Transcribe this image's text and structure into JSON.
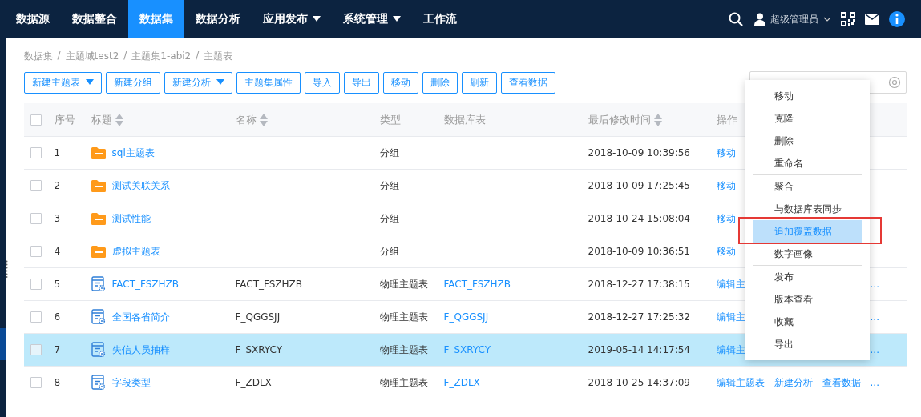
{
  "nav": {
    "items": [
      {
        "label": "数据源",
        "selected": false,
        "dropdown": false
      },
      {
        "label": "数据整合",
        "selected": false,
        "dropdown": false
      },
      {
        "label": "数据集",
        "selected": true,
        "dropdown": false
      },
      {
        "label": "数据分析",
        "selected": false,
        "dropdown": false
      },
      {
        "label": "应用发布",
        "selected": false,
        "dropdown": true
      },
      {
        "label": "系统管理",
        "selected": false,
        "dropdown": true
      },
      {
        "label": "工作流",
        "selected": false,
        "dropdown": false
      }
    ],
    "user": "超级管理员"
  },
  "breadcrumb": {
    "separator": "/",
    "items": [
      "数据集",
      "主题域test2",
      "主题集1-abi2",
      "主题表"
    ]
  },
  "toolbar": [
    {
      "label": "新建主题表",
      "dropdown": true
    },
    {
      "label": "新建分组",
      "dropdown": false
    },
    {
      "label": "新建分析",
      "dropdown": true
    },
    {
      "label": "主题集属性",
      "dropdown": false
    },
    {
      "label": "导入",
      "dropdown": false
    },
    {
      "label": "导出",
      "dropdown": false
    },
    {
      "label": "移动",
      "dropdown": false
    },
    {
      "label": "删除",
      "dropdown": false
    },
    {
      "label": "刷新",
      "dropdown": false
    },
    {
      "label": "查看数据",
      "dropdown": false
    }
  ],
  "table": {
    "all_checked": false,
    "columns": [
      {
        "label": "序号",
        "sortable": false
      },
      {
        "label": "标题",
        "sortable": true
      },
      {
        "label": "名称",
        "sortable": true
      },
      {
        "label": "类型",
        "sortable": false
      },
      {
        "label": "数据库表",
        "sortable": false
      },
      {
        "label": "最后修改时间",
        "sortable": true
      },
      {
        "label": "操作",
        "sortable": false
      }
    ],
    "rows": [
      {
        "index": "1",
        "kind": "folder",
        "title": "sql主题表",
        "name": "",
        "type": "分组",
        "db_table": "",
        "modified": "2018-10-09 10:39:56",
        "actions": [
          "移动"
        ],
        "more": "",
        "selected": false,
        "checked": false
      },
      {
        "index": "2",
        "kind": "folder",
        "title": "测试关联关系",
        "name": "",
        "type": "分组",
        "db_table": "",
        "modified": "2018-10-09 17:25:45",
        "actions": [
          "移动"
        ],
        "more": "",
        "selected": false,
        "checked": false
      },
      {
        "index": "3",
        "kind": "folder",
        "title": "测试性能",
        "name": "",
        "type": "分组",
        "db_table": "",
        "modified": "2018-10-24 15:08:04",
        "actions": [
          "移动"
        ],
        "more": "",
        "selected": false,
        "checked": false
      },
      {
        "index": "4",
        "kind": "folder",
        "title": "虚拟主题表",
        "name": "",
        "type": "分组",
        "db_table": "",
        "modified": "2018-10-09 10:36:51",
        "actions": [
          "移动"
        ],
        "more": "",
        "selected": false,
        "checked": false
      },
      {
        "index": "5",
        "kind": "table",
        "title": "FACT_FSZHZB",
        "name": "FACT_FSZHZB",
        "type": "物理主题表",
        "db_table": "FACT_FSZHZB",
        "modified": "2018-12-27 17:38:15",
        "actions": [
          "编辑主"
        ],
        "more": "...",
        "selected": false,
        "checked": false
      },
      {
        "index": "6",
        "kind": "table",
        "title": "全国各省简介",
        "name": "F_QGGSJJ",
        "type": "物理主题表",
        "db_table": "F_QGGSJJ",
        "modified": "2018-12-27 17:25:32",
        "actions": [
          "编辑主"
        ],
        "more": "...",
        "selected": false,
        "checked": false
      },
      {
        "index": "7",
        "kind": "table",
        "title": "失信人员抽样",
        "name": "F_SXRYCY",
        "type": "物理主题表",
        "db_table": "F_SXRYCY",
        "modified": "2019-05-14 14:17:54",
        "actions": [
          "编辑主"
        ],
        "more": "...",
        "selected": true,
        "checked": false
      },
      {
        "index": "8",
        "kind": "table",
        "title": "字段类型",
        "name": "F_ZDLX",
        "type": "物理主题表",
        "db_table": "F_ZDLX",
        "modified": "2018-10-25 14:37:09",
        "actions": [
          "编辑主题表",
          "新建分析",
          "查看数据"
        ],
        "more": "...",
        "selected": false,
        "checked": false
      }
    ]
  },
  "context_menu": {
    "groups": [
      [
        {
          "label": "移动",
          "selected": false
        },
        {
          "label": "克隆",
          "selected": false
        },
        {
          "label": "删除",
          "selected": false
        },
        {
          "label": "重命名",
          "selected": false
        }
      ],
      [
        {
          "label": "聚合",
          "selected": false
        },
        {
          "label": "与数据库表同步",
          "selected": false
        },
        {
          "label": "追加覆盖数据",
          "selected": true
        },
        {
          "label": "数字画像",
          "selected": false
        }
      ],
      [
        {
          "label": "发布",
          "selected": false
        },
        {
          "label": "版本查看",
          "selected": false
        },
        {
          "label": "收藏",
          "selected": false
        },
        {
          "label": "导出",
          "selected": false
        }
      ]
    ]
  }
}
